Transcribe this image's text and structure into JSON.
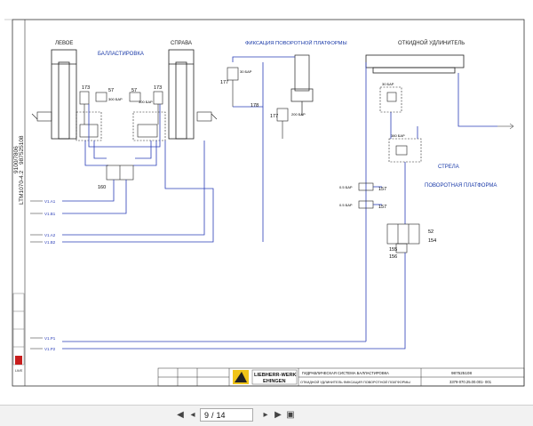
{
  "left_labels": {
    "rotated_1": "LTM1070-4.2",
    "rotated_2": "9100/7806",
    "rotated_3": "987525108"
  },
  "groups": {
    "left": "ЛЕВОЕ",
    "ballast": "БАЛЛАСТИРОВКА",
    "right": "СПРАВА",
    "fix": "ФИКСАЦИЯ ПОВОРОТНОЙ ПЛАТФОРМЫ",
    "ext": "ОТКИДНОЙ УДЛИНИТЕЛЬ",
    "strela": "СТРЕЛА",
    "platform": "ПОВОРОТНАЯ ПЛАТФОРМА"
  },
  "components": {
    "c173a": "173",
    "c57a": "57",
    "c57b": "57",
    "c173b": "173",
    "c177a": "177",
    "c178": "178",
    "c177b": "177",
    "c160": "160",
    "c157a": "157",
    "c157b": "157",
    "c52": "52",
    "c154": "154",
    "c155": "155",
    "c156": "156"
  },
  "pressures": {
    "p_left": "300 БАР",
    "p_right": "300 БАР",
    "p_fix1": "30 БАР",
    "p_fix2": "200 БАР",
    "p_ext1": "30 БАР",
    "p_ext2": "380 БАР",
    "p_v1": "0.5 БАР",
    "p_v2": "0.5 БАР"
  },
  "lines": {
    "l1": "V1.A1",
    "l2": "V1.B1",
    "l3": "V1.A2",
    "l4": "V1.B2",
    "l5": "V1.P1",
    "l6": "V1.P2"
  },
  "title_block": {
    "brand_1": "LIEBHERR-WERK",
    "brand_2": "EHINGEN",
    "desc_1": "ГИДРАВЛИЧЕСКАЯ СИСТЕМА  БАЛЛАСТИРОВКА",
    "desc_2": "ОТКИДНОЙ УДЛИНИТЕЛЬ  ФИКСАЦИЯ ПОВОРОТНОЙ ПЛАТФОРМЫ",
    "doc_no": "987525108",
    "drawing_no": "3379-070.25.00.001- 001"
  },
  "viewer": {
    "page_current": "9",
    "page_sep": "/",
    "page_total": "14"
  }
}
